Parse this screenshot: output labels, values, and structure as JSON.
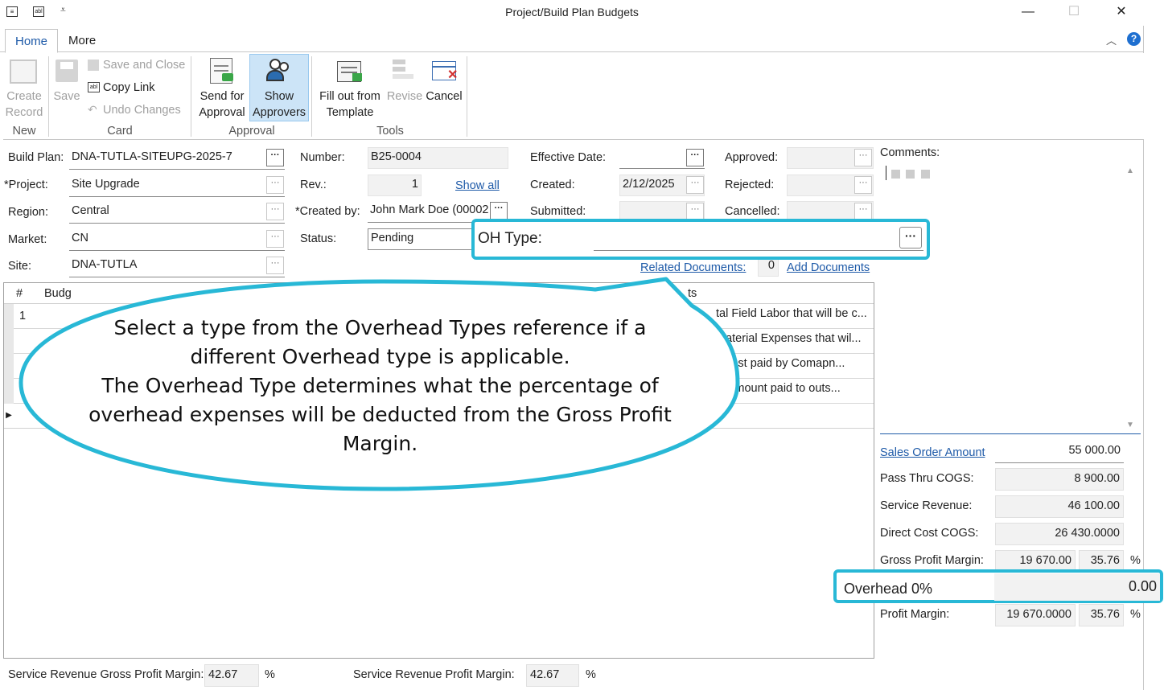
{
  "window": {
    "title": "Project/Build Plan Budgets",
    "minimize": "—",
    "maximize": "☐",
    "close": "✕"
  },
  "tabs": [
    "Home",
    "More"
  ],
  "ribbon": {
    "new": {
      "create": "Create\nRecord",
      "group": "New"
    },
    "card": {
      "save": "Save",
      "save_close": "Save and Close",
      "copy_link": "Copy Link",
      "undo": "Undo Changes",
      "group": "Card"
    },
    "approval": {
      "send": "Send for\nApproval",
      "show": "Show\nApprovers",
      "group": "Approval"
    },
    "tools": {
      "fill": "Fill out from\nTemplate",
      "revise": "Revise",
      "cancel": "Cancel",
      "group": "Tools"
    }
  },
  "form": {
    "build_plan": {
      "label": "Build Plan:",
      "value": "DNA-TUTLA-SITEUPG-2025-7"
    },
    "project": {
      "label": "*Project:",
      "value": "Site Upgrade"
    },
    "region": {
      "label": "Region:",
      "value": "Central"
    },
    "market": {
      "label": "Market:",
      "value": "CN"
    },
    "site": {
      "label": "Site:",
      "value": "DNA-TUTLA"
    },
    "number": {
      "label": "Number:",
      "value": "B25-0004"
    },
    "rev": {
      "label": "Rev.:",
      "value": "1",
      "show_all": "Show all"
    },
    "created_by": {
      "label": "*Created by:",
      "value": "John Mark Doe (00002"
    },
    "status": {
      "label": "Status:",
      "value": "Pending"
    },
    "effective_date": {
      "label": "Effective Date:",
      "value": ""
    },
    "created": {
      "label": "Created:",
      "value": "2/12/2025"
    },
    "submitted": {
      "label": "Submitted:",
      "value": ""
    },
    "approved": {
      "label": "Approved:",
      "value": ""
    },
    "rejected": {
      "label": "Rejected:",
      "value": ""
    },
    "cancelled": {
      "label": "Cancelled:",
      "value": ""
    },
    "related_documents": {
      "label": "Related Documents:",
      "value": "0",
      "add": "Add Documents"
    },
    "oh_type": {
      "label": "OH Type:",
      "value": ""
    }
  },
  "grid": {
    "headers": [
      "#",
      "Budg",
      "ts"
    ],
    "rows": [
      {
        "num": "1",
        "desc": "tal Field Labor that will be c..."
      },
      {
        "num": "",
        "desc": "Material Expenses that wil..."
      },
      {
        "num": "",
        "desc": "r Cost paid by Comapn..."
      },
      {
        "num": "",
        "desc": "al amount paid to outs..."
      }
    ]
  },
  "comments": {
    "label": "Comments:"
  },
  "summary": {
    "sales_order_amount": {
      "label": "Sales Order Amount",
      "value": "55 000.00"
    },
    "pass_thru_cogs": {
      "label": "Pass Thru COGS:",
      "value": "8 900.00"
    },
    "service_revenue": {
      "label": "Service Revenue:",
      "value": "46 100.00"
    },
    "direct_cost_cogs": {
      "label": "Direct Cost COGS:",
      "value": "26 430.0000"
    },
    "gross_profit_margin": {
      "label": "Gross Profit Margin:",
      "value": "19 670.00",
      "pct": "35.76",
      "unit": "%"
    },
    "overhead": {
      "label": "Overhead 0%",
      "value": "0.00"
    },
    "profit_margin": {
      "label": "Profit Margin:",
      "value": "19 670.0000",
      "pct": "35.76",
      "unit": "%"
    }
  },
  "footer": {
    "sr_gpm": {
      "label": "Service Revenue Gross Profit Margin:",
      "value": "42.67",
      "unit": "%"
    },
    "sr_pm": {
      "label": "Service Revenue Profit Margin:",
      "value": "42.67",
      "unit": "%"
    }
  },
  "callout": {
    "text": "Select a type from the Overhead Types reference if a different Overhead type is applicable.\nThe Overhead Type determines what the percentage of overhead expenses will be deducted from the Gross Profit Margin."
  },
  "colors": {
    "callout": "#28b8d6",
    "link": "#1e5aa8"
  }
}
